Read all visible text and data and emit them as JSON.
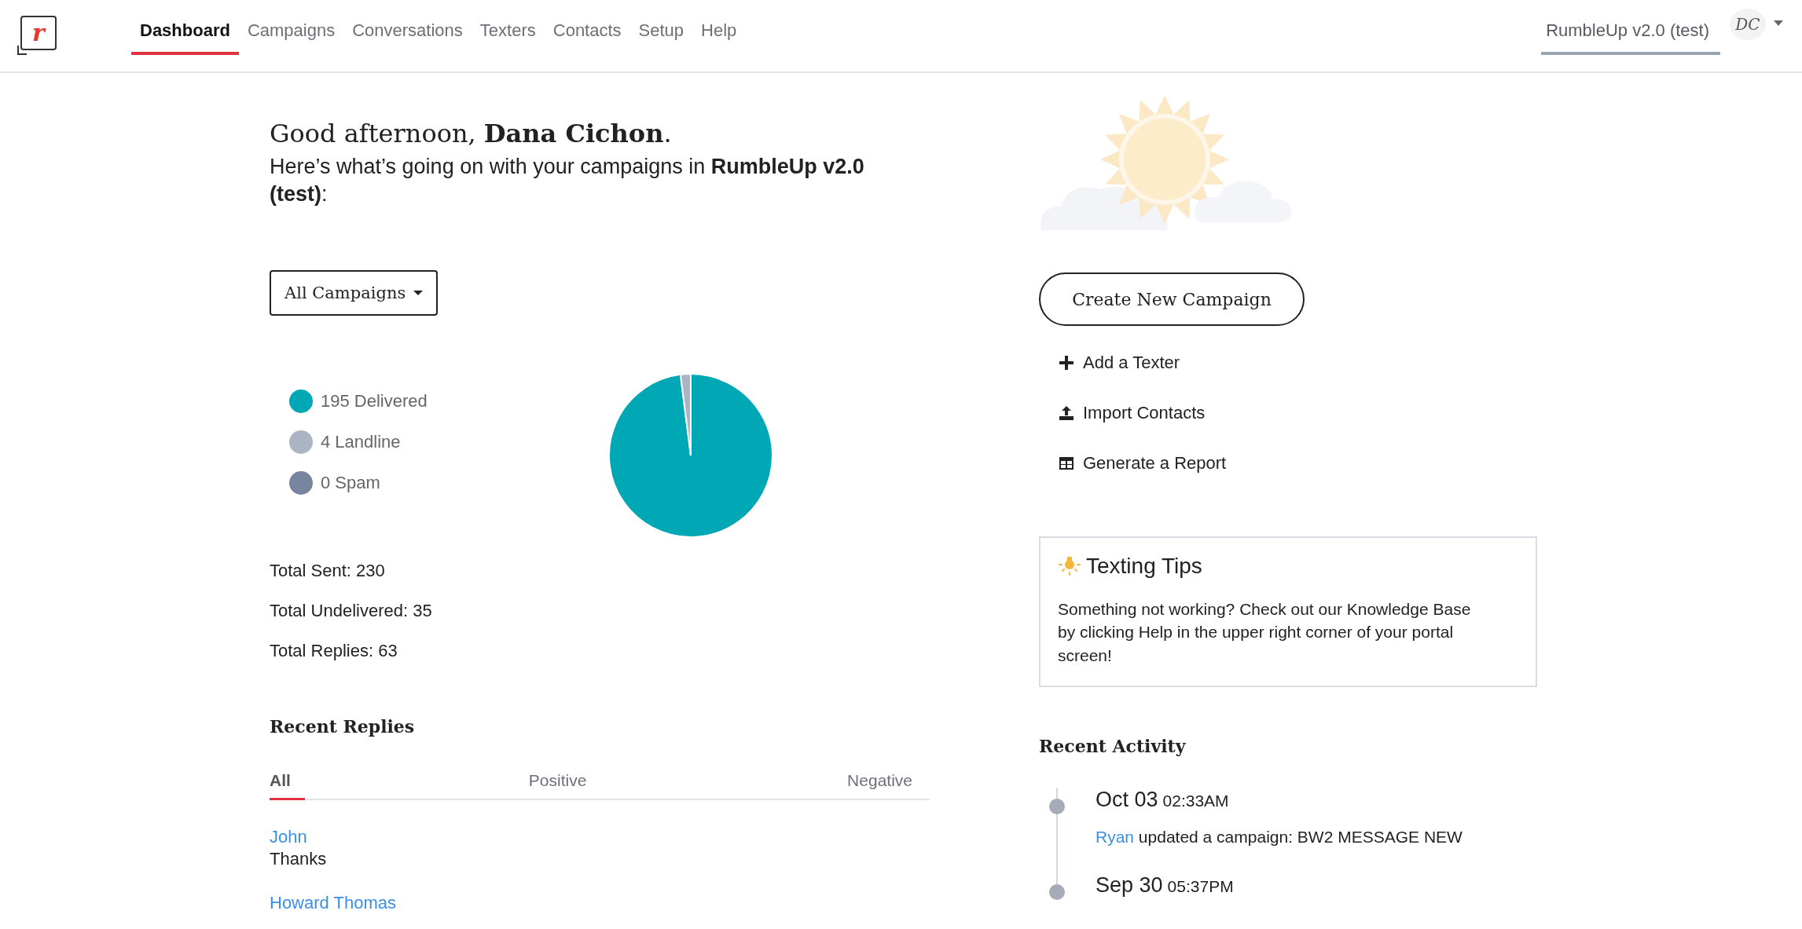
{
  "logo": "r",
  "nav": [
    {
      "label": "Dashboard",
      "selected": true
    },
    {
      "label": "Campaigns",
      "selected": false
    },
    {
      "label": "Conversations",
      "selected": false
    },
    {
      "label": "Texters",
      "selected": false
    },
    {
      "label": "Contacts",
      "selected": false
    },
    {
      "label": "Setup",
      "selected": false
    },
    {
      "label": "Help",
      "selected": false
    }
  ],
  "account": {
    "name": "RumbleUp v2.0 (test)",
    "initials": "DC"
  },
  "greeting": "Good afternoon, **Dana Cichon**.",
  "subtitle": "Here’s what’s going on with your campaigns in **RumbleUp v2.0 (test)**:",
  "campaign_filter": "All Campaigns",
  "legend": [
    {
      "color": "#00a8b5"
    },
    {
      "color": "#aab4c3"
    },
    {
      "color": "#77869e"
    }
  ],
  "chart_data": {
    "type": "pie",
    "categories": [
      "195 Delivered",
      "4 Landline",
      "0 Spam"
    ],
    "values": [
      195,
      4,
      0
    ]
  },
  "totals": [
    "Total Sent: 230",
    "Total Undelivered: 35",
    "Total Replies: 63"
  ],
  "recent_replies": {
    "title": "Recent Replies",
    "tabs": [
      {
        "label": "All",
        "selected": true
      },
      {
        "label": "Positive",
        "selected": false
      },
      {
        "label": "Negative",
        "selected": false
      }
    ],
    "items": [
      {
        "name": "John",
        "message": "Thanks"
      },
      {
        "name": "Howard Thomas"
      }
    ]
  },
  "create_button": "Create New Campaign",
  "actions": [
    {
      "kind": "plus",
      "label": "Add a Texter"
    },
    {
      "kind": "upload",
      "label": "Import Contacts"
    },
    {
      "kind": "table",
      "label": "Generate a Report"
    }
  ],
  "tips": {
    "title": "Texting Tips",
    "body": "Something not working? Check out our Knowledge Base by clicking Help in the upper right corner of your portal screen!"
  },
  "recent_activity": {
    "title": "Recent Activity",
    "items": [
      {
        "date": "Oct 03",
        "time": "02:33AM",
        "actor": "Ryan",
        "action": "updated a campaign: BW2 MESSAGE NEW"
      },
      {
        "date": "Sep 30",
        "time": "05:37PM"
      }
    ]
  }
}
